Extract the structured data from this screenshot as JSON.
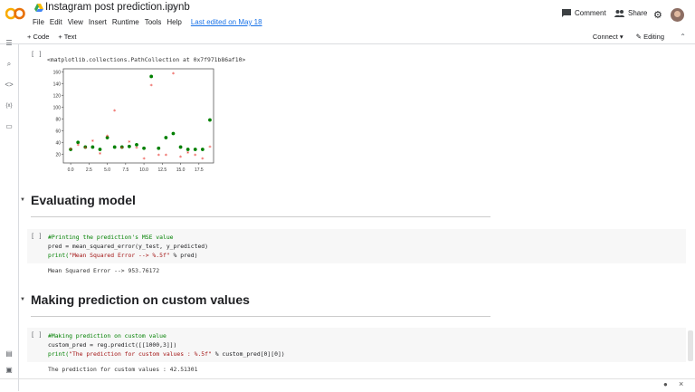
{
  "header": {
    "title": "Instagram post prediction.ipynb",
    "menu": [
      "File",
      "Edit",
      "View",
      "Insert",
      "Runtime",
      "Tools",
      "Help"
    ],
    "last_edited": "Last edited on May 18",
    "comment_label": "Comment",
    "share_label": "Share"
  },
  "toolbar": {
    "add_code": "+ Code",
    "add_text": "+ Text",
    "connect": "Connect",
    "editing": "Editing"
  },
  "cells": {
    "plot_cell": {
      "bracket": "[ ]",
      "output_text": "<matplotlib.collections.PathCollection at 0x7f971b86af10>"
    },
    "section1": {
      "heading": "Evaluating model"
    },
    "mse_cell": {
      "bracket": "[ ]",
      "line1": "#Printing the prediction's MSE value",
      "line2": "pred = mean_squared_error(y_test, y_predicted)",
      "line3a": "print(",
      "line3b": "\"Mean Squared Error   --> %.5f\"",
      "line3c": " % pred)",
      "output": "Mean Squared Error   --> 953.76172"
    },
    "section2": {
      "heading": "Making prediction on custom values"
    },
    "custom_cell": {
      "bracket": "[ ]",
      "line1": "#Making prediction on custom value",
      "line2": "custom_pred = reg.predict([[1000,3]])",
      "line3a": "print(",
      "line3b": "\"The prediction for custom values : %.5f\"",
      "line3c": " % custom_pred[0][0])",
      "output": "The prediction for custom values : 42.51301"
    }
  },
  "chart_data": {
    "type": "scatter",
    "xlim": [
      -1,
      19.5
    ],
    "ylim": [
      5,
      165
    ],
    "x_ticks": [
      "0.0",
      "2.5",
      "5.0",
      "7.5",
      "10.0",
      "12.5",
      "15.0",
      "17.5"
    ],
    "y_ticks": [
      "20",
      "40",
      "60",
      "80",
      "100",
      "120",
      "140",
      "160"
    ],
    "series": [
      {
        "color": "#008000",
        "marker": "circle",
        "x": [
          0,
          1,
          2,
          3,
          4,
          5,
          6,
          7,
          8,
          9,
          10,
          11,
          12,
          13,
          14,
          15,
          16,
          17,
          18,
          19
        ],
        "y": [
          28,
          40,
          32,
          32,
          28,
          48,
          32,
          32,
          33,
          36,
          30,
          152,
          30,
          48,
          55,
          32,
          28,
          28,
          28,
          78
        ]
      },
      {
        "color": "#e8342c",
        "marker": "star",
        "x": [
          0,
          1,
          2,
          3,
          4,
          5,
          6,
          7,
          8,
          9,
          10,
          11,
          12,
          13,
          14,
          15,
          16,
          17,
          18,
          19
        ],
        "y": [
          28,
          35,
          30,
          42,
          20,
          50,
          93,
          30,
          40,
          30,
          12,
          136,
          18,
          18,
          156,
          15,
          22,
          18,
          12,
          32
        ]
      }
    ]
  }
}
